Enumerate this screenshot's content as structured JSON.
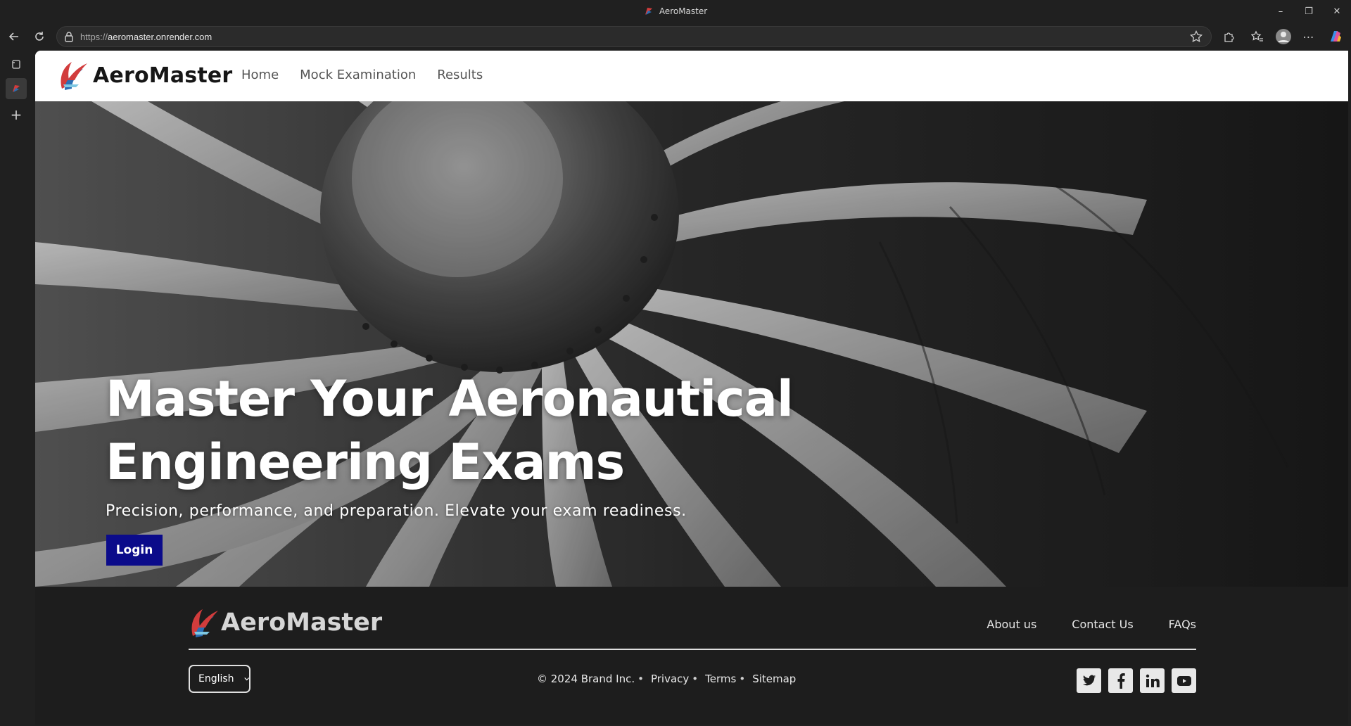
{
  "window": {
    "title": "AeroMaster"
  },
  "browser": {
    "url_protocol": "https://",
    "url_host": "aeromaster.onrender.com"
  },
  "navbar": {
    "brand": "AeroMaster",
    "links": [
      "Home",
      "Mock Examination",
      "Results"
    ]
  },
  "hero": {
    "title_line1": "Master Your Aeronautical",
    "title_line2": "Engineering Exams",
    "subtitle": "Precision, performance, and preparation. Elevate your exam readiness.",
    "login_label": "Login"
  },
  "footer": {
    "brand": "AeroMaster",
    "links": [
      "About us",
      "Contact Us",
      "FAQs"
    ],
    "language": "English",
    "copyright": "© 2024 Brand Inc.",
    "legal": [
      "Privacy",
      "Terms",
      "Sitemap"
    ],
    "separator": "•",
    "social_icons": [
      "twitter-icon",
      "facebook-icon",
      "linkedin-icon",
      "youtube-icon"
    ]
  },
  "colors": {
    "login_button": "#0b0b8a",
    "footer_bg": "#1d1d1d",
    "logo_red": "#d23c3c",
    "logo_blue": "#2a6fb5"
  }
}
